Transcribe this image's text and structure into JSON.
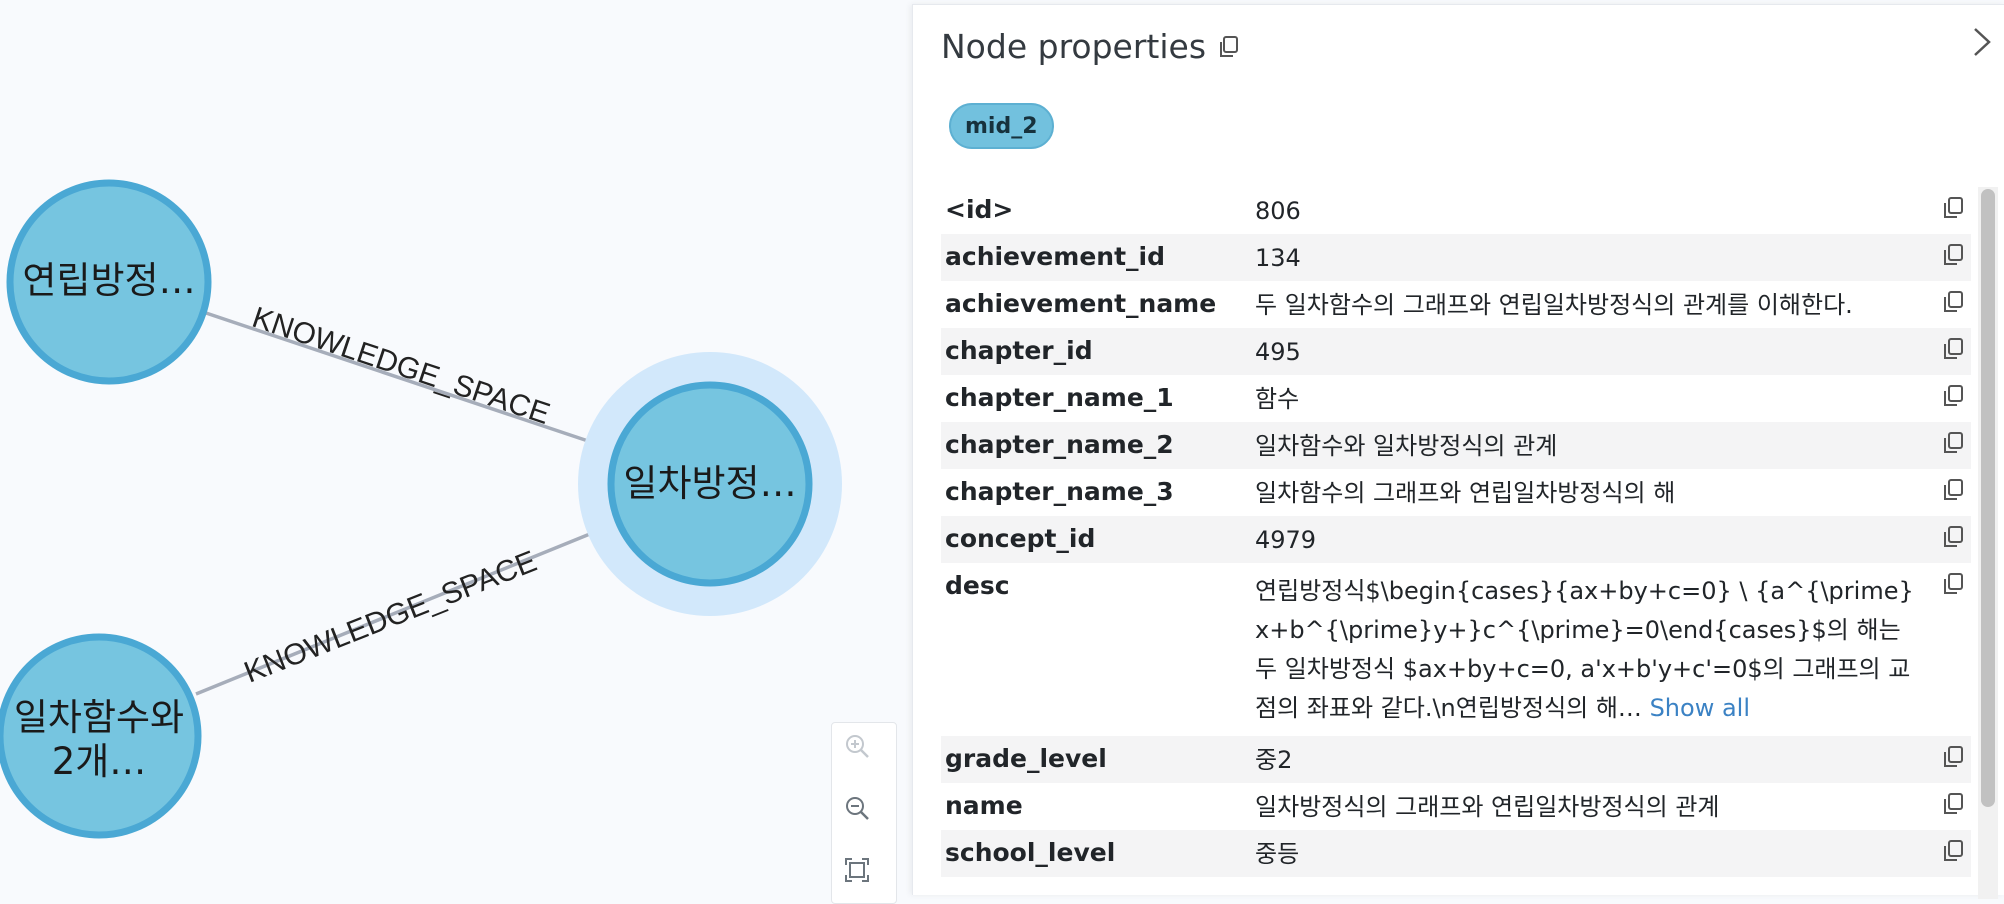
{
  "graph": {
    "nodes": [
      {
        "label": "연립방정…",
        "selected": false
      },
      {
        "label": "일차방정…",
        "selected": true
      },
      {
        "label": "일차함수와",
        "label2": "2개…",
        "selected": false
      }
    ],
    "edges": [
      {
        "label": "KNOWLEDGE_SPACE"
      },
      {
        "label": "KNOWLEDGE_SPACE"
      }
    ],
    "colors": {
      "node_fill": "#76c5e0",
      "node_stroke": "#4aa8d4",
      "selection_halo": "#d2e8fb",
      "edge": "#a6adba"
    }
  },
  "panel": {
    "title": "Node properties",
    "label_chip": "mid_2",
    "show_all": "Show all",
    "properties": [
      {
        "key": "<id>",
        "value": "806"
      },
      {
        "key": "achievement_id",
        "value": "134"
      },
      {
        "key": "achievement_name",
        "value": "두 일차함수의 그래프와 연립일차방정식의 관계를 이해한다."
      },
      {
        "key": "chapter_id",
        "value": "495"
      },
      {
        "key": "chapter_name_1",
        "value": "함수"
      },
      {
        "key": "chapter_name_2",
        "value": " 일차함수와 일차방정식의 관계"
      },
      {
        "key": "chapter_name_3",
        "value": " 일차함수의 그래프와 연립일차방정식의 해"
      },
      {
        "key": "concept_id",
        "value": "4979"
      },
      {
        "key": "desc",
        "value": "연립방정식$\\begin{cases}{ax+by+c=0} \\ {a^{\\prime}x+b^{\\prime}y+}c^{\\prime}=0\\end{cases}$의 해는 두 일차방정식 $ax+by+c=0, a'x+b'y+c'=0$의 그래프의 교점의 좌표와 같다.\\n연립방정식의 해… "
      },
      {
        "key": "grade_level",
        "value": "중2"
      },
      {
        "key": "name",
        "value": "일차방정식의 그래프와 연립일차방정식의 관계"
      },
      {
        "key": "school_level",
        "value": "중등"
      }
    ]
  }
}
